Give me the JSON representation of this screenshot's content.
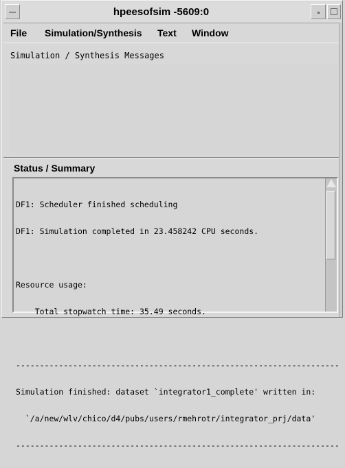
{
  "window": {
    "title": "hpeesofsim -5609:0"
  },
  "menubar": {
    "items": [
      {
        "label": "File"
      },
      {
        "label": "Simulation/Synthesis"
      },
      {
        "label": "Text"
      },
      {
        "label": "Window"
      }
    ]
  },
  "messages": {
    "header": "Simulation / Synthesis Messages"
  },
  "status": {
    "title": "Status / Summary",
    "lines": [
      "DF1: Scheduler finished scheduling",
      "DF1: Simulation completed in 23.458242 CPU seconds.",
      "",
      "Resource usage:",
      "    Total stopwatch time: 35.49 seconds.",
      "",
      "--------------------------------------------------------------------",
      "Simulation finished: dataset `integrator1_complete' written in:",
      "  `/a/new/wlv/chico/d4/pubs/users/rmehrotr/integrator_prj/data'",
      "--------------------------------------------------------------------"
    ]
  },
  "icons": {
    "window_menu": "window-menu-icon",
    "minimize": "minimize-icon",
    "maximize": "maximize-icon",
    "scroll_up": "scroll-up-arrow-icon"
  }
}
